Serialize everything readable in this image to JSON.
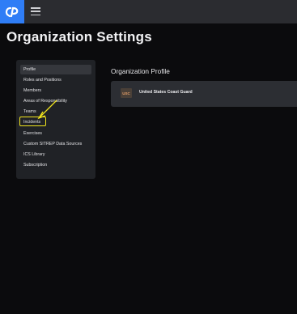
{
  "app": {
    "logo_icon": "brand-logo-icon",
    "menu_icon": "hamburger-menu-icon",
    "brand_color": "#2f7df6"
  },
  "page": {
    "title": "Organization Settings"
  },
  "sidebar": {
    "items": [
      {
        "label": "Profile",
        "active": true
      },
      {
        "label": "Roles and Positions"
      },
      {
        "label": "Members"
      },
      {
        "label": "Areas of Responsibility"
      },
      {
        "label": "Teams"
      },
      {
        "label": "Incidents",
        "highlighted": true
      },
      {
        "label": "Exercises"
      },
      {
        "label": "Custom SITREP Data Sources"
      },
      {
        "label": "ICS Library"
      },
      {
        "label": "Subscription"
      }
    ],
    "highlight_color": "#f1e51e"
  },
  "main": {
    "section_title": "Organization Profile",
    "organization": {
      "badge": "USC",
      "name": "United States Coast Guard"
    }
  }
}
